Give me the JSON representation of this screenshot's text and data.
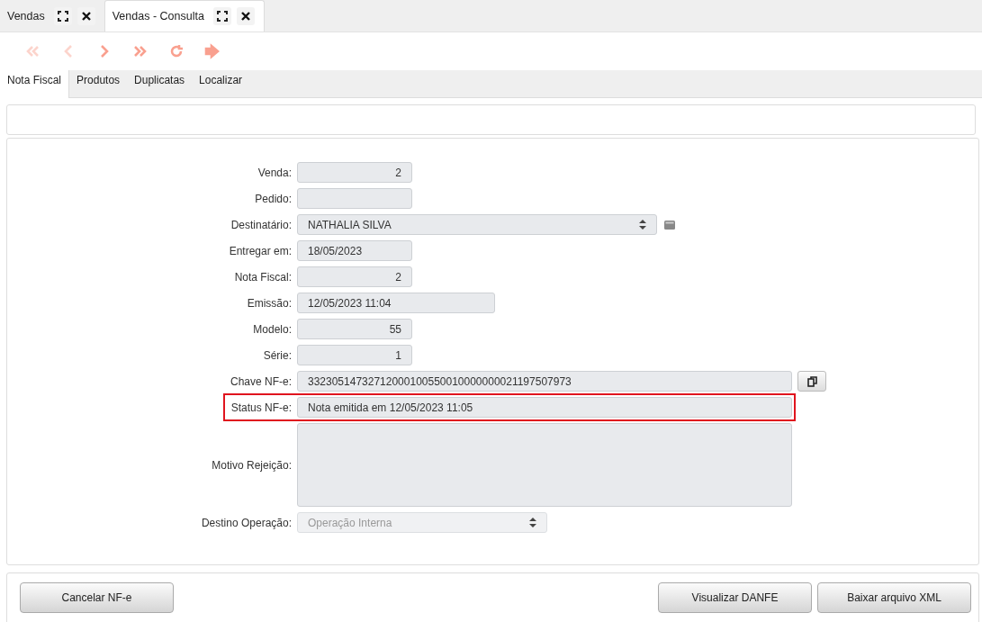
{
  "window_tabs": [
    {
      "label": "Vendas",
      "selected": false
    },
    {
      "label": "Vendas - Consulta",
      "selected": true
    }
  ],
  "toolbar": [
    {
      "kind": "first",
      "disabled": true
    },
    {
      "kind": "prev",
      "disabled": true
    },
    {
      "kind": "next",
      "disabled": false
    },
    {
      "kind": "last",
      "disabled": false
    },
    {
      "kind": "refresh",
      "disabled": false
    },
    {
      "kind": "exit",
      "disabled": false
    }
  ],
  "tabs": [
    {
      "label": "Nota Fiscal",
      "selected": true
    },
    {
      "label": "Produtos",
      "selected": false
    },
    {
      "label": "Duplicatas",
      "selected": false
    },
    {
      "label": "Localizar",
      "selected": false
    }
  ],
  "fields": [
    {
      "label": "Venda:",
      "value": "2",
      "kind": "number",
      "disabled": false,
      "highlighted": false
    },
    {
      "label": "Pedido:",
      "kind": "number",
      "disabled": false,
      "highlighted": false
    },
    {
      "label": "Destinatário:",
      "value": "NATHALIA SILVA",
      "kind": "lookup",
      "disabled": false,
      "highlighted": false
    },
    {
      "label": "Entregar em:",
      "value": "18/05/2023",
      "kind": "date",
      "disabled": false,
      "highlighted": false
    },
    {
      "label": "Nota Fiscal:",
      "value": "2",
      "kind": "number",
      "disabled": false,
      "highlighted": false
    },
    {
      "label": "Emissão:",
      "value": "12/05/2023 11:04",
      "kind": "datetime",
      "disabled": false,
      "highlighted": false
    },
    {
      "label": "Modelo:",
      "value": "55",
      "kind": "number",
      "disabled": false,
      "highlighted": false
    },
    {
      "label": "Série:",
      "value": "1",
      "kind": "number",
      "disabled": false,
      "highlighted": false
    },
    {
      "label": "Chave NF-e:",
      "value": "33230514732712000100550010000000021197507973",
      "kind": "key",
      "disabled": false,
      "highlighted": false
    },
    {
      "label": "Status NF-e:",
      "value": "Nota emitida em 12/05/2023 11:05",
      "kind": "status",
      "disabled": false,
      "highlighted": true
    },
    {
      "label": "Motivo Rejeição:",
      "kind": "textarea",
      "disabled": false,
      "highlighted": false
    },
    {
      "label": "Destino Operação:",
      "value": "Operação Interna",
      "kind": "select",
      "disabled": true,
      "highlighted": false
    }
  ],
  "footer": {
    "left_buttons": [
      "Cancelar NF-e"
    ],
    "right_buttons": [
      "Visualizar DANFE",
      "Baixar arquivo XML"
    ]
  }
}
